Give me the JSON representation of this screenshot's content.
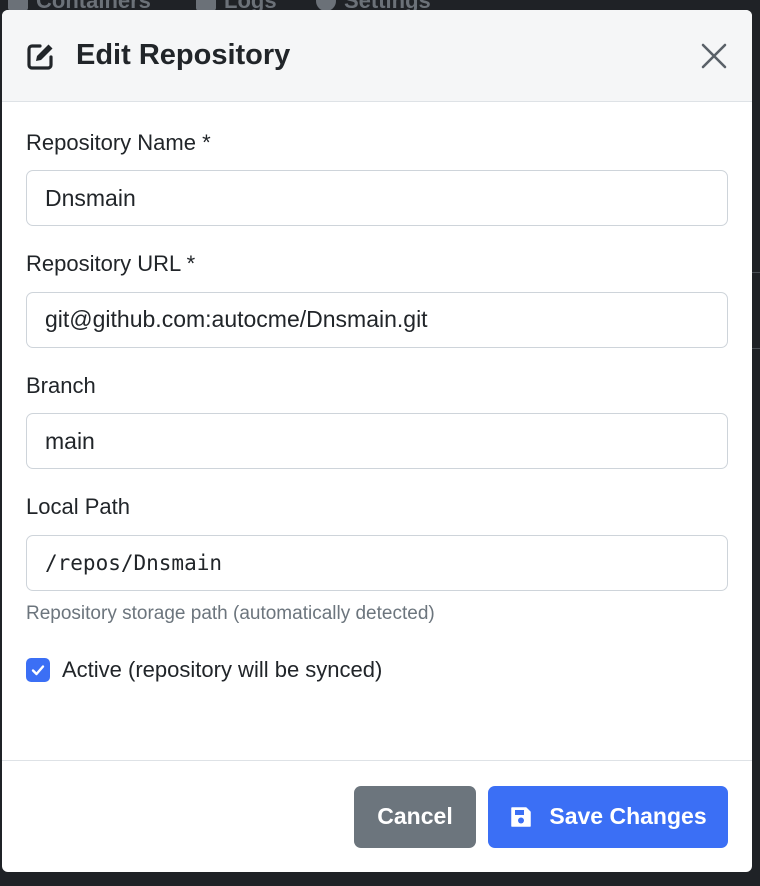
{
  "background_nav": {
    "items": [
      "Containers",
      "Logs",
      "Settings"
    ]
  },
  "modal": {
    "title": "Edit Repository",
    "icons": {
      "header": "edit-icon",
      "close": "close-icon",
      "save": "floppy-disk-icon",
      "checkbox": "checkmark-icon"
    },
    "fields": {
      "name": {
        "label": "Repository Name *",
        "value": "Dnsmain"
      },
      "url": {
        "label": "Repository URL *",
        "value": "git@github.com:autocme/Dnsmain.git"
      },
      "branch": {
        "label": "Branch",
        "value": "main"
      },
      "path": {
        "label": "Local Path",
        "value": "/repos/Dnsmain",
        "help": "Repository storage path (automatically detected)"
      }
    },
    "active": {
      "checked": true,
      "label": "Active (repository will be synced)"
    },
    "footer": {
      "cancel_label": "Cancel",
      "save_label": "Save Changes"
    }
  },
  "colors": {
    "primary": "#3b6ff5",
    "secondary": "#6c757d",
    "backdrop": "#1f2226"
  }
}
